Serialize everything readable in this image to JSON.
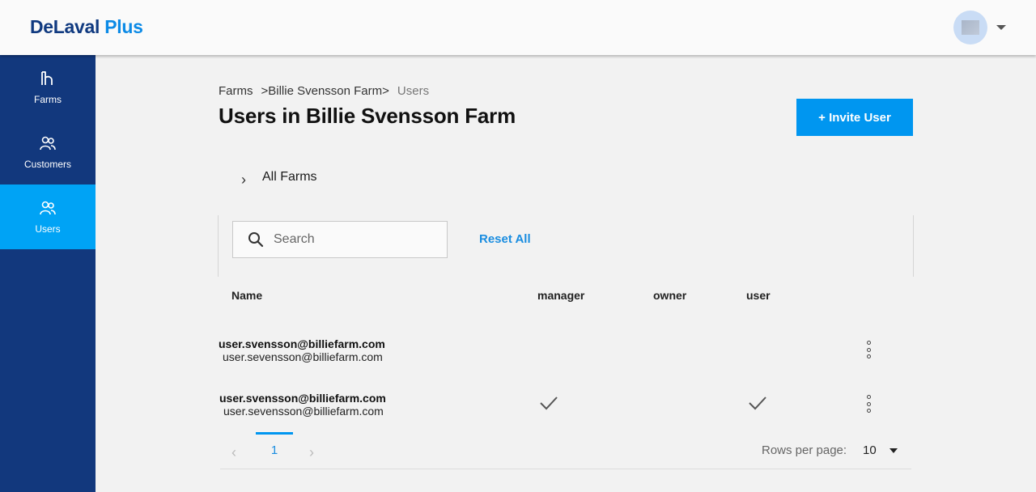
{
  "app": {
    "brand_part1": "DeLaval",
    "brand_part2": "Plus"
  },
  "sidebar": {
    "items": [
      {
        "label": "Farms",
        "icon": "farm-icon"
      },
      {
        "label": "Customers",
        "icon": "customers-icon"
      },
      {
        "label": "Users",
        "icon": "users-icon",
        "active": true
      }
    ]
  },
  "breadcrumb": {
    "items": [
      "Farms",
      ">Billie Svensson Farm>",
      "Users"
    ]
  },
  "page": {
    "title": "Users in Billie Svensson Farm",
    "invite_label": "+ Invite User"
  },
  "farms_toggle": {
    "label": "All Farms"
  },
  "filters": {
    "search_placeholder": "Search",
    "reset_label": "Reset All"
  },
  "table": {
    "headers": [
      "Name",
      "manager",
      "owner",
      "user"
    ],
    "rows": [
      {
        "email": "user.svensson@billiefarm.com",
        "sub": "user.sevensson@billiefarm.com",
        "manager": false,
        "owner": false,
        "user": false
      },
      {
        "email": "user.svensson@billiefarm.com",
        "sub": "user.sevensson@billiefarm.com",
        "manager": true,
        "owner": false,
        "user": true
      }
    ]
  },
  "pagination": {
    "current_page": "1",
    "rows_per_page_label": "Rows per page:",
    "rows_per_page_value": "10"
  },
  "colors": {
    "brand_dark": "#103a80",
    "brand_light": "#0b8ae6",
    "sidebar_bg": "#12387d",
    "sidebar_active": "#00a3f5",
    "primary_button": "#0096f0"
  }
}
